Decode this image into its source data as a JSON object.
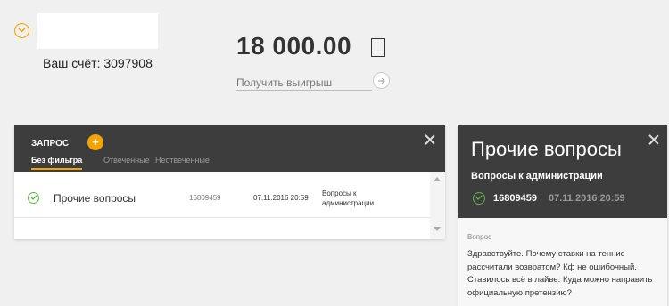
{
  "account": {
    "label": "Ваш счёт: 3097908"
  },
  "balance": {
    "amount": "18 000.00"
  },
  "withdraw": {
    "placeholder": "Получить выигрыш"
  },
  "requests": {
    "title": "ЗАПРОС",
    "add_label": "+",
    "tabs": [
      {
        "label": "Без фильтра",
        "active": true
      },
      {
        "label": "Отвеченные",
        "active": false
      },
      {
        "label": "Неотвеченные",
        "active": false
      }
    ],
    "rows": [
      {
        "subject": "Прочие вопросы",
        "id": "16809459",
        "date": "07.11.2016 20:59",
        "category": "Вопросы к администрации"
      }
    ]
  },
  "detail": {
    "title": "Прочие вопросы",
    "category": "Вопросы к администрации",
    "id": "16809459",
    "date": "07.11.2016 20:59",
    "question_label": "Вопрос",
    "question_text": "Здравствуйте. Почему ставки на теннис рассчитали возвратом? Кф не ошибочный. Ставилось всё в лайве. Куда можно направить официальную претензию?"
  },
  "colors": {
    "accent": "#f4a300",
    "header_bg": "#3d3d3d",
    "success": "#5fb346",
    "page_bg": "#f0f0f0"
  },
  "icons": {
    "collapse": "chevron-down-icon",
    "currency": "currency-icon",
    "submit": "arrow-right-icon",
    "status": "check-circle-icon",
    "close": "close-icon"
  }
}
